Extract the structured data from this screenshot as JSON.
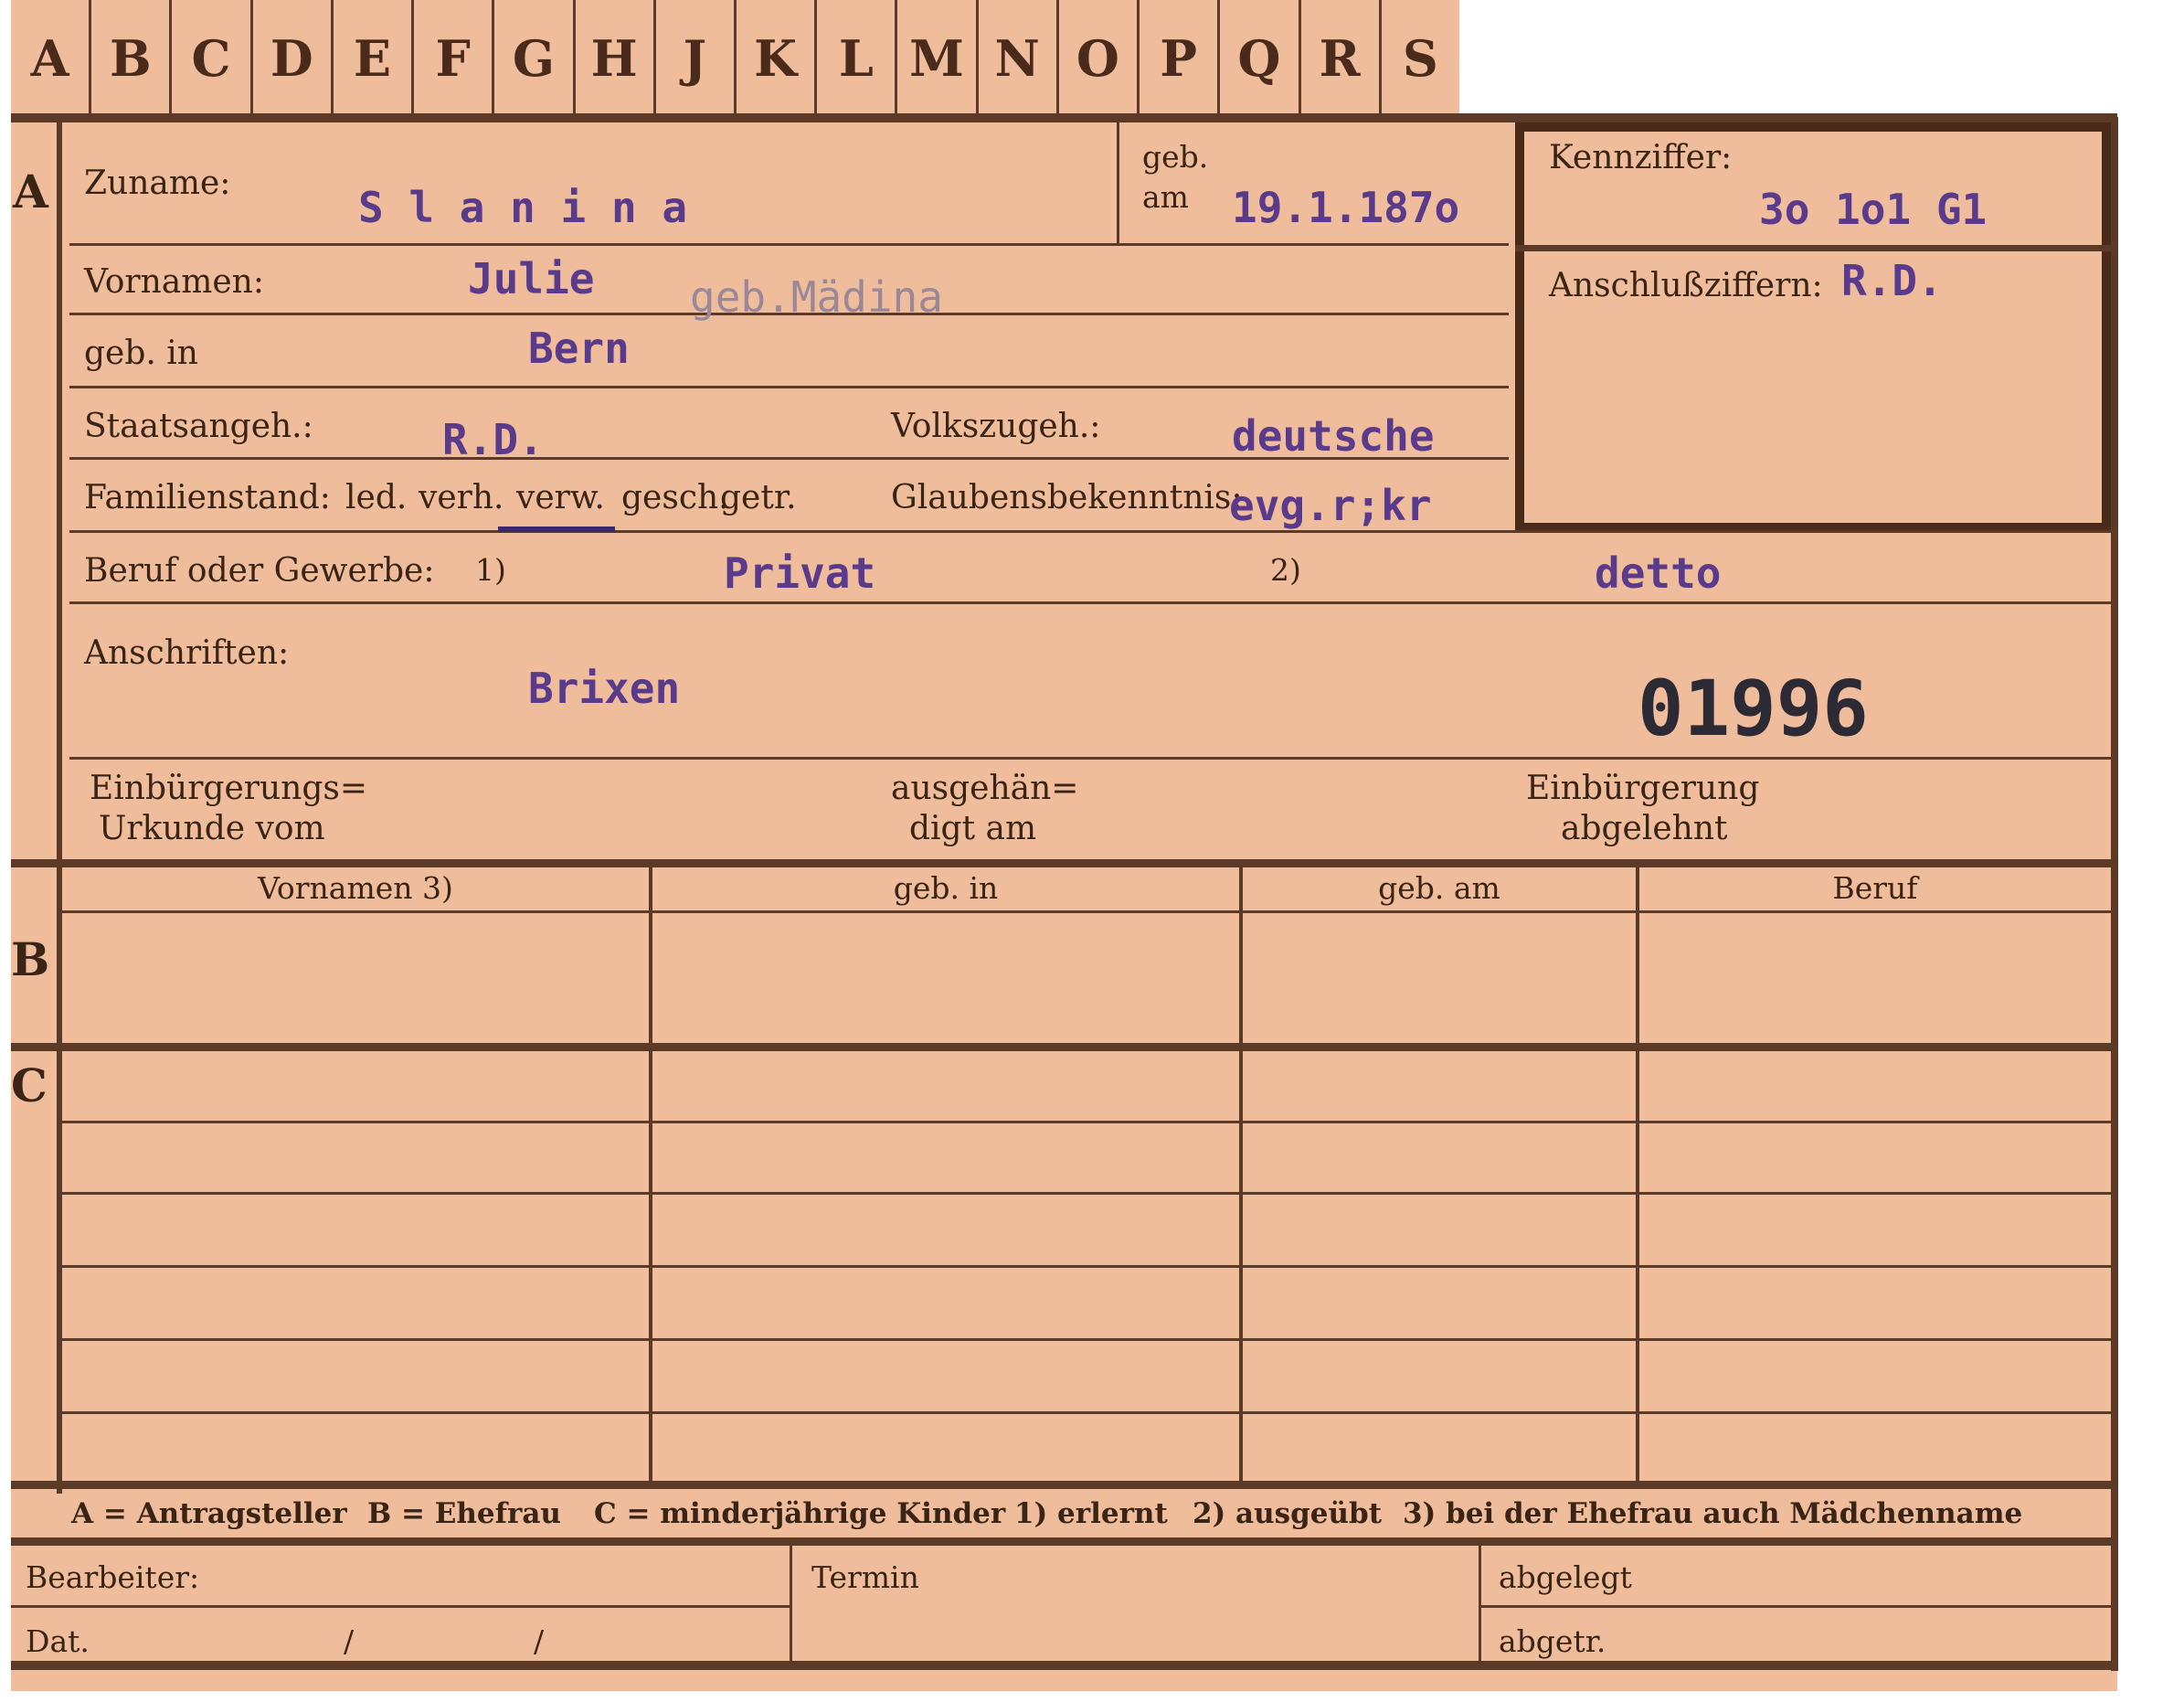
{
  "tabs": [
    "A",
    "B",
    "C",
    "D",
    "E",
    "F",
    "G",
    "H",
    "J",
    "K",
    "L",
    "M",
    "N",
    "O",
    "P",
    "Q",
    "R",
    "S"
  ],
  "section_a": {
    "marker": "A",
    "surname_label": "Zuname:",
    "surname_value": "S l a n i n a",
    "birth_label_1": "geb.",
    "birth_label_2": "am",
    "birth_date": "19.1.187o",
    "given_label": "Vornamen:",
    "given_value": "Julie",
    "maiden_value": "geb.Mädina",
    "birthplace_label": "geb. in",
    "birthplace_value": "Bern",
    "citizenship_label": "Staatsangeh.:",
    "citizenship_value": "R.D.",
    "ethnicity_label": "Volkszugeh.:",
    "ethnicity_value": "deutsche",
    "marital_label": "Familienstand:",
    "marital_options": [
      "led.",
      "verh.",
      "verw.",
      "gesch.",
      "getr."
    ],
    "religion_label": "Glaubensbekenntnis:",
    "religion_value": "evg.r;kr",
    "occupation_label": "Beruf oder Gewerbe:",
    "occ_note_1": "1)",
    "occupation_value_1": "Privat",
    "occ_note_2": "2)",
    "occupation_value_2": "detto",
    "address_label": "Anschriften:",
    "address_value": "Brixen",
    "stamp_number": "01996",
    "naturalization_label_1": "Einbürgerungs=",
    "naturalization_label_2": "Urkunde vom",
    "handed_label_1": "ausgehän=",
    "handed_label_2": "digt am",
    "rejected_label_1": "Einbürgerung",
    "rejected_label_2": "abgelehnt"
  },
  "side_box": {
    "code_label": "Kennziffer:",
    "code_value": "3o 1o1    G1",
    "connection_label": "Anschlußziffern:",
    "connection_value": "R.D."
  },
  "section_b": {
    "marker": "B",
    "columns": [
      "Vornamen 3)",
      "geb. in",
      "geb. am",
      "Beruf"
    ]
  },
  "section_c": {
    "marker": "C"
  },
  "legend": {
    "a": "A = Antragsteller",
    "b": "B = Ehefrau",
    "c": "C = minderjährige Kinder",
    "n1": "1) erlernt",
    "n2": "2) ausgeübt",
    "n3": "3) bei der Ehefrau auch Mädchenname"
  },
  "footer": {
    "clerk_label": "Bearbeiter:",
    "date_label": "Dat.",
    "slash": "/",
    "deadline_label": "Termin",
    "filed_label": "abgelegt",
    "removed_label": "abgetr."
  }
}
